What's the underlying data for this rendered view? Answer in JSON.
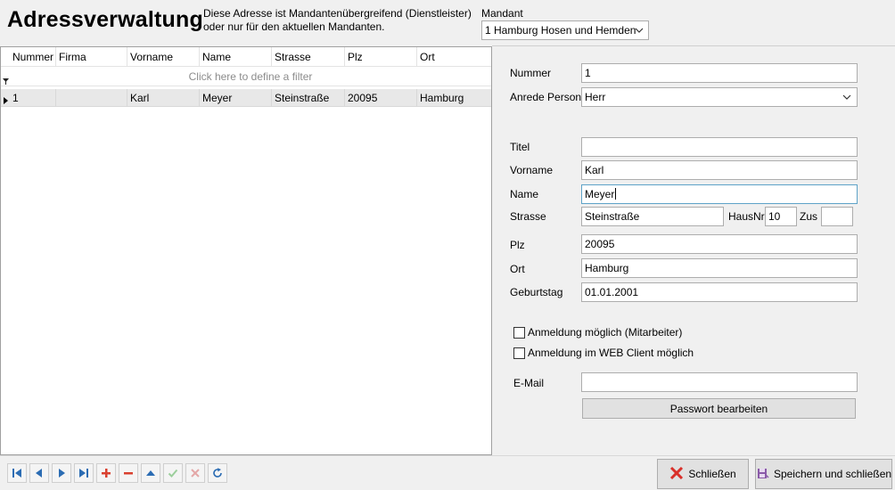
{
  "header": {
    "title": "Adressverwaltung",
    "info_line1": "Diese Adresse ist Mandantenübergreifend (Dienstleister)",
    "info_line2": "oder nur für den aktuellen Mandanten.",
    "mandant_label": "Mandant",
    "mandant_value": "1 Hamburg Hosen und Hemden"
  },
  "grid": {
    "columns": [
      "Nummer",
      "Firma",
      "Vorname",
      "Name",
      "Strasse",
      "Plz",
      "Ort"
    ],
    "filter_placeholder": "Click here to define a filter",
    "rows": [
      [
        "1",
        "",
        "Karl",
        "Meyer",
        "Steinstraße",
        "20095",
        "Hamburg"
      ]
    ]
  },
  "form": {
    "nummer_label": "Nummer",
    "nummer_value": "1",
    "anrede_label": "Anrede Person",
    "anrede_value": "Herr",
    "titel_label": "Titel",
    "titel_value": "",
    "vorname_label": "Vorname",
    "vorname_value": "Karl",
    "name_label": "Name",
    "name_value": "Meyer",
    "strasse_label": "Strasse",
    "strasse_value": "Steinstraße",
    "hausnr_label": "HausNr",
    "hausnr_value": "10",
    "zus_label": "Zus",
    "zus_value": "",
    "plz_label": "Plz",
    "plz_value": "20095",
    "ort_label": "Ort",
    "ort_value": "Hamburg",
    "geburtstag_label": "Geburtstag",
    "geburtstag_value": "01.01.2001",
    "anmeldung_mitarbeiter_label": "Anmeldung möglich (Mitarbeiter)",
    "anmeldung_mitarbeiter_checked": false,
    "anmeldung_web_label": "Anmeldung im WEB Client möglich",
    "anmeldung_web_checked": false,
    "email_label": "E-Mail",
    "email_value": "",
    "passwort_button": "Passwort bearbeiten"
  },
  "navigator": {
    "buttons": [
      "first-icon",
      "prev-icon",
      "next-icon",
      "last-icon",
      "add-icon",
      "delete-icon",
      "up-icon",
      "confirm-icon",
      "cancel-icon",
      "refresh-icon"
    ]
  },
  "footer": {
    "close_button": "Schließen",
    "save_close_button": "Speichern und schließen"
  },
  "colors": {
    "nav_blue": "#2b6cb3",
    "nav_red": "#d9402f",
    "nav_disabled_green": "#9ccf9c",
    "nav_disabled_red": "#e4a7a7",
    "focus_border": "#5ea3c8",
    "selected_row": "#e8e8e8"
  }
}
